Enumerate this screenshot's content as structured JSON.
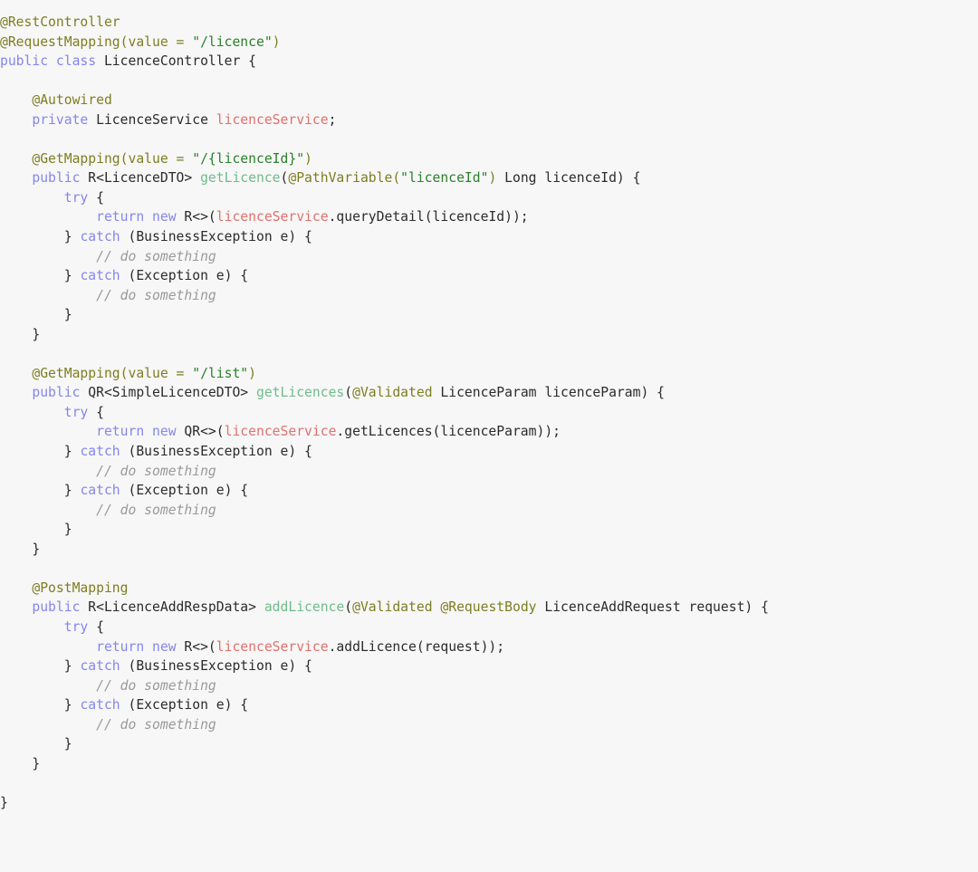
{
  "editor": {
    "language": "java",
    "file_name": "LicenceController.java",
    "background_color": "#f7f7f7",
    "default_text_color": "#2b2b2b"
  },
  "theme": {
    "keyword": "#8585ef",
    "annotation": "#7d7d22",
    "string": "#2b802b",
    "comment": "#9a9a9a",
    "field": "#e2706c",
    "method": "#6fbc8b",
    "plain": "#2b2b2b"
  },
  "code": {
    "lines": [
      [
        {
          "t": "@RestController",
          "c": "annotation"
        }
      ],
      [
        {
          "t": "@RequestMapping",
          "c": "annotation"
        },
        {
          "t": "(",
          "c": "annotation"
        },
        {
          "t": "value",
          "c": "annotation"
        },
        {
          "t": " = ",
          "c": "annotation"
        },
        {
          "t": "\"/licence\"",
          "c": "string"
        },
        {
          "t": ")",
          "c": "annotation"
        }
      ],
      [
        {
          "t": "public class",
          "c": "keyword"
        },
        {
          "t": " LicenceController {",
          "c": "plain"
        }
      ],
      [],
      [
        {
          "t": "    ",
          "c": "plain"
        },
        {
          "t": "@Autowired",
          "c": "annotation"
        }
      ],
      [
        {
          "t": "    ",
          "c": "plain"
        },
        {
          "t": "private",
          "c": "keyword"
        },
        {
          "t": " LicenceService ",
          "c": "plain"
        },
        {
          "t": "licenceService",
          "c": "field"
        },
        {
          "t": ";",
          "c": "plain"
        }
      ],
      [],
      [
        {
          "t": "    ",
          "c": "plain"
        },
        {
          "t": "@GetMapping",
          "c": "annotation"
        },
        {
          "t": "(",
          "c": "annotation"
        },
        {
          "t": "value",
          "c": "annotation"
        },
        {
          "t": " = ",
          "c": "annotation"
        },
        {
          "t": "\"/{licenceId}\"",
          "c": "string"
        },
        {
          "t": ")",
          "c": "annotation"
        }
      ],
      [
        {
          "t": "    ",
          "c": "plain"
        },
        {
          "t": "public",
          "c": "keyword"
        },
        {
          "t": " R<LicenceDTO> ",
          "c": "plain"
        },
        {
          "t": "getLicence",
          "c": "method"
        },
        {
          "t": "(",
          "c": "plain"
        },
        {
          "t": "@PathVariable",
          "c": "annotation"
        },
        {
          "t": "(",
          "c": "annotation"
        },
        {
          "t": "\"licenceId\"",
          "c": "string"
        },
        {
          "t": ")",
          "c": "annotation"
        },
        {
          "t": " Long licenceId) {",
          "c": "plain"
        }
      ],
      [
        {
          "t": "        ",
          "c": "plain"
        },
        {
          "t": "try",
          "c": "keyword"
        },
        {
          "t": " {",
          "c": "plain"
        }
      ],
      [
        {
          "t": "            ",
          "c": "plain"
        },
        {
          "t": "return new",
          "c": "keyword"
        },
        {
          "t": " R<>(",
          "c": "plain"
        },
        {
          "t": "licenceService",
          "c": "field"
        },
        {
          "t": ".queryDetail(licenceId));",
          "c": "plain"
        }
      ],
      [
        {
          "t": "        } ",
          "c": "plain"
        },
        {
          "t": "catch",
          "c": "keyword"
        },
        {
          "t": " (BusinessException e) {",
          "c": "plain"
        }
      ],
      [
        {
          "t": "            ",
          "c": "plain"
        },
        {
          "t": "// do something",
          "c": "comment"
        }
      ],
      [
        {
          "t": "        } ",
          "c": "plain"
        },
        {
          "t": "catch",
          "c": "keyword"
        },
        {
          "t": " (Exception e) {",
          "c": "plain"
        }
      ],
      [
        {
          "t": "            ",
          "c": "plain"
        },
        {
          "t": "// do something",
          "c": "comment"
        }
      ],
      [
        {
          "t": "        }",
          "c": "plain"
        }
      ],
      [
        {
          "t": "    }",
          "c": "plain"
        }
      ],
      [],
      [
        {
          "t": "    ",
          "c": "plain"
        },
        {
          "t": "@GetMapping",
          "c": "annotation"
        },
        {
          "t": "(",
          "c": "annotation"
        },
        {
          "t": "value",
          "c": "annotation"
        },
        {
          "t": " = ",
          "c": "annotation"
        },
        {
          "t": "\"/list\"",
          "c": "string"
        },
        {
          "t": ")",
          "c": "annotation"
        }
      ],
      [
        {
          "t": "    ",
          "c": "plain"
        },
        {
          "t": "public",
          "c": "keyword"
        },
        {
          "t": " QR<SimpleLicenceDTO> ",
          "c": "plain"
        },
        {
          "t": "getLicences",
          "c": "method"
        },
        {
          "t": "(",
          "c": "plain"
        },
        {
          "t": "@Validated",
          "c": "annotation"
        },
        {
          "t": " LicenceParam licenceParam) {",
          "c": "plain"
        }
      ],
      [
        {
          "t": "        ",
          "c": "plain"
        },
        {
          "t": "try",
          "c": "keyword"
        },
        {
          "t": " {",
          "c": "plain"
        }
      ],
      [
        {
          "t": "            ",
          "c": "plain"
        },
        {
          "t": "return new",
          "c": "keyword"
        },
        {
          "t": " QR<>(",
          "c": "plain"
        },
        {
          "t": "licenceService",
          "c": "field"
        },
        {
          "t": ".getLicences(licenceParam));",
          "c": "plain"
        }
      ],
      [
        {
          "t": "        } ",
          "c": "plain"
        },
        {
          "t": "catch",
          "c": "keyword"
        },
        {
          "t": " (BusinessException e) {",
          "c": "plain"
        }
      ],
      [
        {
          "t": "            ",
          "c": "plain"
        },
        {
          "t": "// do something",
          "c": "comment"
        }
      ],
      [
        {
          "t": "        } ",
          "c": "plain"
        },
        {
          "t": "catch",
          "c": "keyword"
        },
        {
          "t": " (Exception e) {",
          "c": "plain"
        }
      ],
      [
        {
          "t": "            ",
          "c": "plain"
        },
        {
          "t": "// do something",
          "c": "comment"
        }
      ],
      [
        {
          "t": "        }",
          "c": "plain"
        }
      ],
      [
        {
          "t": "    }",
          "c": "plain"
        }
      ],
      [],
      [
        {
          "t": "    ",
          "c": "plain"
        },
        {
          "t": "@PostMapping",
          "c": "annotation"
        }
      ],
      [
        {
          "t": "    ",
          "c": "plain"
        },
        {
          "t": "public",
          "c": "keyword"
        },
        {
          "t": " R<LicenceAddRespData> ",
          "c": "plain"
        },
        {
          "t": "addLicence",
          "c": "method"
        },
        {
          "t": "(",
          "c": "plain"
        },
        {
          "t": "@Validated",
          "c": "annotation"
        },
        {
          "t": " ",
          "c": "plain"
        },
        {
          "t": "@RequestBody",
          "c": "annotation"
        },
        {
          "t": " LicenceAddRequest request) {",
          "c": "plain"
        }
      ],
      [
        {
          "t": "        ",
          "c": "plain"
        },
        {
          "t": "try",
          "c": "keyword"
        },
        {
          "t": " {",
          "c": "plain"
        }
      ],
      [
        {
          "t": "            ",
          "c": "plain"
        },
        {
          "t": "return new",
          "c": "keyword"
        },
        {
          "t": " R<>(",
          "c": "plain"
        },
        {
          "t": "licenceService",
          "c": "field"
        },
        {
          "t": ".addLicence(request));",
          "c": "plain"
        }
      ],
      [
        {
          "t": "        } ",
          "c": "plain"
        },
        {
          "t": "catch",
          "c": "keyword"
        },
        {
          "t": " (BusinessException e) {",
          "c": "plain"
        }
      ],
      [
        {
          "t": "            ",
          "c": "plain"
        },
        {
          "t": "// do something",
          "c": "comment"
        }
      ],
      [
        {
          "t": "        } ",
          "c": "plain"
        },
        {
          "t": "catch",
          "c": "keyword"
        },
        {
          "t": " (Exception e) {",
          "c": "plain"
        }
      ],
      [
        {
          "t": "            ",
          "c": "plain"
        },
        {
          "t": "// do something",
          "c": "comment"
        }
      ],
      [
        {
          "t": "        }",
          "c": "plain"
        }
      ],
      [
        {
          "t": "    }",
          "c": "plain"
        }
      ],
      [],
      [
        {
          "t": "}",
          "c": "plain"
        }
      ]
    ]
  }
}
